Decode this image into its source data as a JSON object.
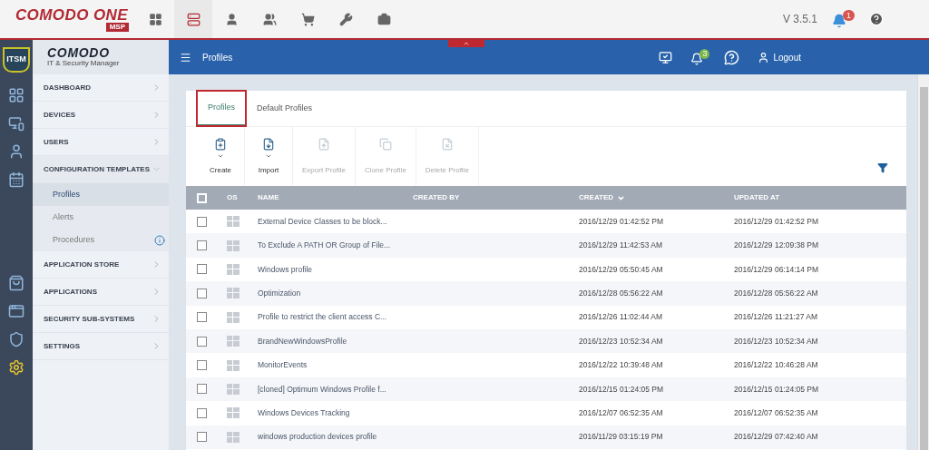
{
  "top_bar": {
    "logo": {
      "name": "COMODO ONE",
      "badge": "MSP"
    },
    "nav": [
      {
        "selected": false
      },
      {
        "selected": true
      },
      {
        "selected": false
      },
      {
        "selected": false
      },
      {
        "selected": false
      },
      {
        "selected": false
      },
      {
        "selected": false
      }
    ],
    "version": "V 3.5.1",
    "notifications": "1"
  },
  "rail": {
    "badge": "ITSM",
    "icons": [
      {
        "selected": false
      },
      {
        "selected": false
      },
      {
        "selected": false
      },
      {
        "selected": false
      },
      {
        "selected": false
      },
      {
        "selected": false
      },
      {
        "selected": false
      },
      {
        "selected": true
      }
    ]
  },
  "sidebar": {
    "brand": "COMODO",
    "subtitle": "IT & Security Manager",
    "items": [
      {
        "label": "DASHBOARD",
        "expanded": false
      },
      {
        "label": "DEVICES",
        "expanded": false
      },
      {
        "label": "USERS",
        "expanded": false
      },
      {
        "label": "CONFIGURATION TEMPLATES",
        "expanded": true,
        "children": [
          {
            "label": "Profiles",
            "selected": true,
            "info": false
          },
          {
            "label": "Alerts",
            "selected": false,
            "info": false
          },
          {
            "label": "Procedures",
            "selected": false,
            "info": true
          }
        ]
      },
      {
        "label": "APPLICATION STORE",
        "expanded": false
      },
      {
        "label": "APPLICATIONS",
        "expanded": false
      },
      {
        "label": "SECURITY SUB-SYSTEMS",
        "expanded": false
      },
      {
        "label": "SETTINGS",
        "expanded": false
      }
    ]
  },
  "header": {
    "title": "Profiles",
    "notifications": "3",
    "logout": "Logout"
  },
  "tabs": [
    {
      "label": "Profiles",
      "selected": true,
      "highlighted": true
    },
    {
      "label": "Default Profiles",
      "selected": false,
      "highlighted": false
    }
  ],
  "toolbar": [
    {
      "label": "Create",
      "disabled": false,
      "dropdown": true
    },
    {
      "label": "Import",
      "disabled": false,
      "dropdown": true
    },
    {
      "label": "Export Profile",
      "disabled": true,
      "dropdown": false
    },
    {
      "label": "Clone Profile",
      "disabled": true,
      "dropdown": false
    },
    {
      "label": "Delete Profile",
      "disabled": true,
      "dropdown": false
    }
  ],
  "table": {
    "all_checked": false,
    "columns": [
      {
        "label": "OS",
        "sorted": false
      },
      {
        "label": "NAME",
        "sorted": false
      },
      {
        "label": "CREATED BY",
        "sorted": false
      },
      {
        "label": "CREATED",
        "sorted": true
      },
      {
        "label": "UPDATED AT",
        "sorted": false
      }
    ],
    "rows": [
      {
        "checked": false,
        "name": "External Device Classes to be block...",
        "created": "2016/12/29 01:42:52 PM",
        "updated": "2016/12/29 01:42:52 PM"
      },
      {
        "checked": false,
        "name": "To Exclude A PATH OR Group of File...",
        "created": "2016/12/29 11:42:53 AM",
        "updated": "2016/12/29 12:09:38 PM"
      },
      {
        "checked": false,
        "name": "Windows profile",
        "created": "2016/12/29 05:50:45 AM",
        "updated": "2016/12/29 06:14:14 PM"
      },
      {
        "checked": false,
        "name": "Optimization",
        "created": "2016/12/28 05:56:22 AM",
        "updated": "2016/12/28 05:56:22 AM"
      },
      {
        "checked": false,
        "name": "Profile to restrict the client access C...",
        "created": "2016/12/26 11:02:44 AM",
        "updated": "2016/12/26 11:21:27 AM"
      },
      {
        "checked": false,
        "name": "BrandNewWindowsProfile",
        "created": "2016/12/23 10:52:34 AM",
        "updated": "2016/12/23 10:52:34 AM"
      },
      {
        "checked": false,
        "name": "MonitorEvents",
        "created": "2016/12/22 10:39:48 AM",
        "updated": "2016/12/22 10:46:28 AM"
      },
      {
        "checked": false,
        "name": "[cloned] Optimum Windows Profile f...",
        "created": "2016/12/15 01:24:05 PM",
        "updated": "2016/12/15 01:24:05 PM"
      },
      {
        "checked": false,
        "name": "Windows Devices Tracking",
        "created": "2016/12/07 06:52:35 AM",
        "updated": "2016/12/07 06:52:35 AM"
      },
      {
        "checked": false,
        "name": "windows production devices profile",
        "created": "2016/11/29 03:15:19 PM",
        "updated": "2016/12/29 07:42:40 AM"
      }
    ]
  }
}
